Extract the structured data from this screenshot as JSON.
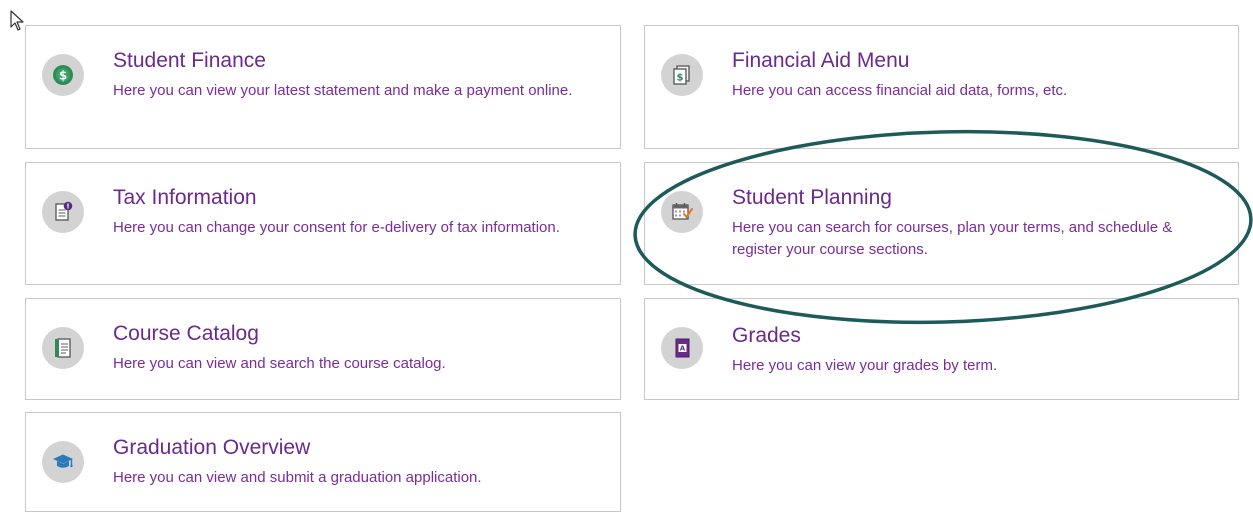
{
  "tiles": [
    {
      "title": "Student Finance",
      "desc": "Here you can view your latest statement and make a payment online.",
      "icon": "dollar-coin-icon"
    },
    {
      "title": "Financial Aid Menu",
      "desc": "Here you can access financial aid data, forms, etc.",
      "icon": "money-document-icon"
    },
    {
      "title": "Tax Information",
      "desc": "Here you can change your consent for e-delivery of tax information.",
      "icon": "tax-document-icon"
    },
    {
      "title": "Student Planning",
      "desc": "Here you can search for courses, plan your terms, and schedule & register your course sections.",
      "icon": "calendar-check-icon"
    },
    {
      "title": "Course Catalog",
      "desc": "Here you can view and search the course catalog.",
      "icon": "catalog-book-icon"
    },
    {
      "title": "Grades",
      "desc": "Here you can view your grades by term.",
      "icon": "grade-book-icon"
    },
    {
      "title": "Graduation Overview",
      "desc": "Here you can view and submit a graduation application.",
      "icon": "graduation-cap-icon"
    }
  ],
  "colors": {
    "title": "#6a2a8c",
    "highlight_ellipse": "#1f5a5a",
    "icon_bg": "#d3d3d3"
  }
}
